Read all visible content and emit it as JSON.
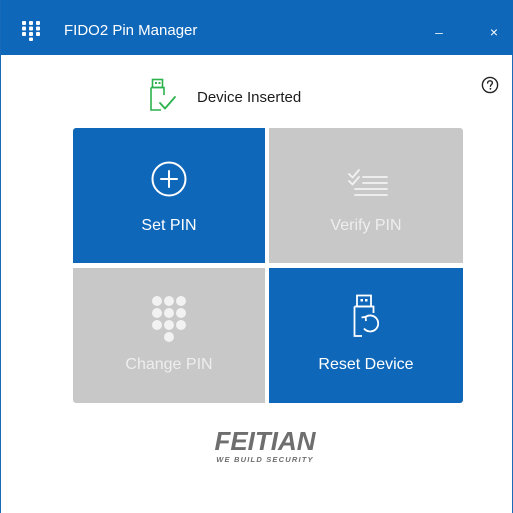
{
  "window": {
    "title": "FIDO2 Pin Manager",
    "app_icon": "keypad-grid-icon",
    "minimize_label": "–",
    "close_label": "×",
    "help_icon": "question-circle-icon"
  },
  "status": {
    "icon": "usb-key-check-icon",
    "text": "Device Inserted"
  },
  "tiles": [
    {
      "label": "Set PIN",
      "icon": "plus-circle-icon",
      "enabled": true
    },
    {
      "label": "Verify PIN",
      "icon": "checklist-icon",
      "enabled": false
    },
    {
      "label": "Change PIN",
      "icon": "keypad-icon",
      "enabled": false
    },
    {
      "label": "Reset Device",
      "icon": "usb-reset-icon",
      "enabled": true
    }
  ],
  "branding": {
    "logo_text": "FEITIAN",
    "tagline": "WE BUILD SECURITY"
  },
  "colors": {
    "accent": "#0f67b9",
    "disabled_tile": "#c8c8c8",
    "check_green": "#2bb24c"
  }
}
